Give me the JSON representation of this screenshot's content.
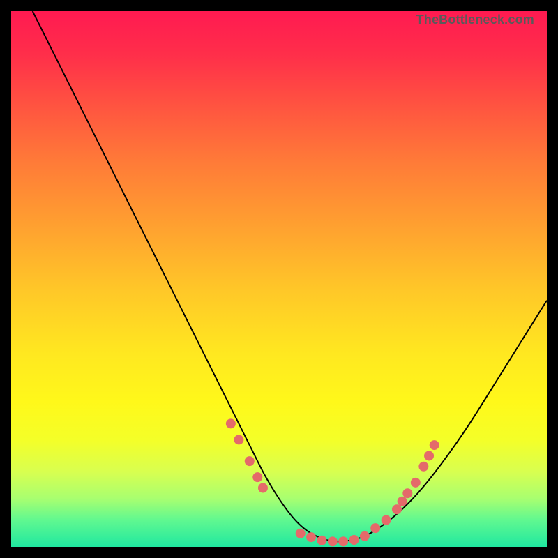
{
  "attribution": "TheBottleneck.com",
  "colors": {
    "background": "#000000",
    "curve_stroke": "#000000",
    "marker_fill": "#e46a6a",
    "marker_stroke": "#d85858"
  },
  "chart_data": {
    "type": "line",
    "title": "",
    "xlabel": "",
    "ylabel": "",
    "xlim": [
      0,
      100
    ],
    "ylim": [
      0,
      100
    ],
    "series": [
      {
        "name": "bottleneck-curve",
        "x": [
          4,
          10,
          15,
          20,
          25,
          30,
          35,
          40,
          45,
          48,
          52,
          55,
          58,
          60,
          62,
          65,
          68,
          72,
          76,
          80,
          85,
          90,
          95,
          100
        ],
        "y": [
          100,
          88,
          78,
          68,
          58,
          48,
          38,
          28,
          18,
          12,
          6,
          3,
          1.5,
          1,
          1,
          1.5,
          3,
          6,
          10,
          15,
          22,
          30,
          38,
          46
        ]
      }
    ],
    "markers": [
      {
        "x": 41,
        "y": 23
      },
      {
        "x": 42.5,
        "y": 20
      },
      {
        "x": 44.5,
        "y": 16
      },
      {
        "x": 46,
        "y": 13
      },
      {
        "x": 47,
        "y": 11
      },
      {
        "x": 54,
        "y": 2.5
      },
      {
        "x": 56,
        "y": 1.8
      },
      {
        "x": 58,
        "y": 1.2
      },
      {
        "x": 60,
        "y": 1
      },
      {
        "x": 62,
        "y": 1
      },
      {
        "x": 64,
        "y": 1.3
      },
      {
        "x": 66,
        "y": 2
      },
      {
        "x": 68,
        "y": 3.5
      },
      {
        "x": 70,
        "y": 5
      },
      {
        "x": 72,
        "y": 7
      },
      {
        "x": 73,
        "y": 8.5
      },
      {
        "x": 74,
        "y": 10
      },
      {
        "x": 75.5,
        "y": 12
      },
      {
        "x": 77,
        "y": 15
      },
      {
        "x": 78,
        "y": 17
      },
      {
        "x": 79,
        "y": 19
      }
    ]
  }
}
